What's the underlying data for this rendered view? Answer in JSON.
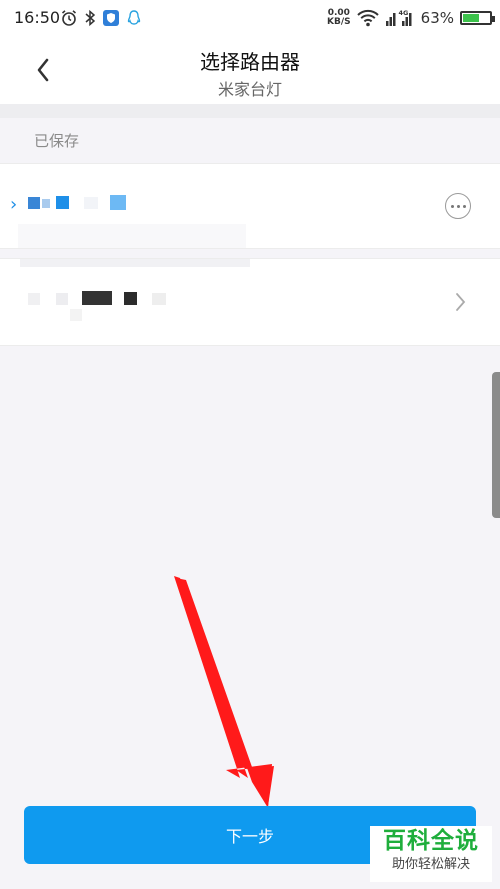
{
  "status_bar": {
    "time": "16:50",
    "net_speed_value": "0.00",
    "net_speed_unit": "KB/S",
    "battery_text": "63%",
    "battery_level": 0.63,
    "signal_label": "4G"
  },
  "header": {
    "title": "选择路由器",
    "subtitle": "米家台灯"
  },
  "saved_section": {
    "label": "已保存"
  },
  "networks": [
    {
      "name_state": "pixelated",
      "has_more_button": true
    },
    {
      "name_state": "pixelated",
      "has_chevron": true
    }
  ],
  "footer": {
    "next_label": "下一步"
  },
  "watermark": {
    "title": "百科全说",
    "slogan": "助你轻松解决"
  },
  "colors": {
    "accent": "#0f9aef",
    "battery_fill": "#3cc24b",
    "annotation_arrow": "#ff1a1a",
    "watermark_green": "#1fae3c"
  }
}
